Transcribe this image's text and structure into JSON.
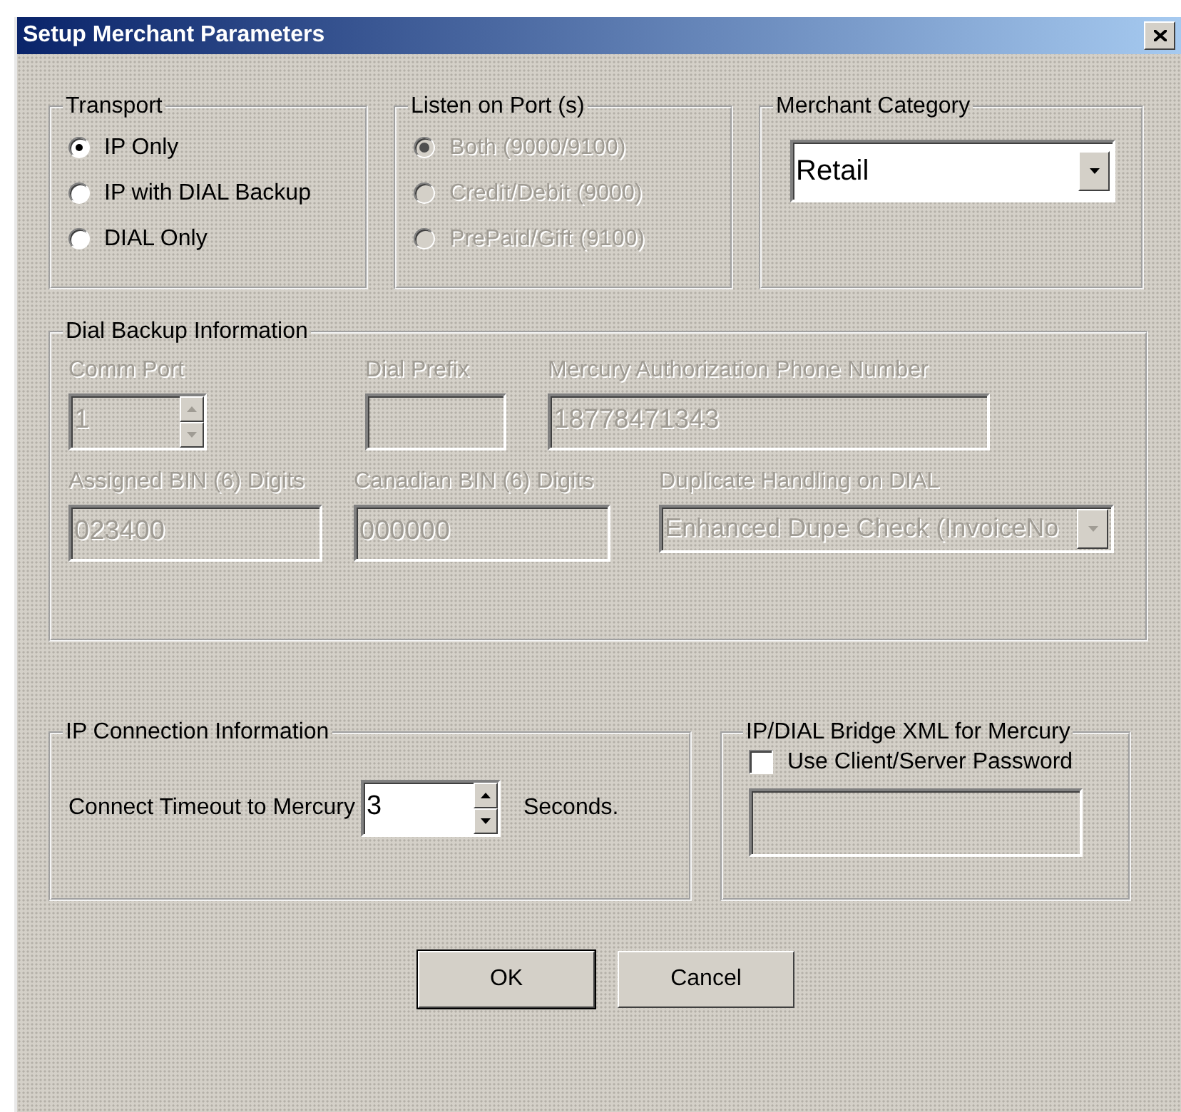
{
  "window": {
    "title": "Setup Merchant Parameters"
  },
  "transport": {
    "label": "Transport",
    "disabled": false,
    "options": [
      {
        "label": "IP Only",
        "selected": true
      },
      {
        "label": "IP with DIAL Backup",
        "selected": false
      },
      {
        "label": "DIAL Only",
        "selected": false
      }
    ]
  },
  "listen_port": {
    "label": "Listen on Port (s)",
    "disabled": true,
    "options": [
      {
        "label": "Both (9000/9100)",
        "selected": true
      },
      {
        "label": "Credit/Debit (9000)",
        "selected": false
      },
      {
        "label": "PrePaid/Gift (9100)",
        "selected": false
      }
    ]
  },
  "merchant_category": {
    "label": "Merchant Category",
    "value": "Retail",
    "disabled": false
  },
  "dial_backup": {
    "label": "Dial Backup Information",
    "rows": [
      [
        {
          "kind": "spinner",
          "label": "Comm Port",
          "value": "1",
          "disabled": true
        },
        {
          "kind": "text",
          "label": "Dial Prefix",
          "disabled": true
        },
        {
          "kind": "text",
          "label": "Mercury Authorization Phone Number",
          "value": "18778471343",
          "disabled": true
        }
      ],
      [
        {
          "kind": "text",
          "label": "Assigned BIN (6) Digits",
          "value": "023400",
          "disabled": true
        },
        {
          "kind": "text",
          "label": "Canadian BIN (6) Digits",
          "value": "000000",
          "disabled": true
        },
        {
          "kind": "select",
          "label": "Duplicate Handling on DIAL",
          "value": "Enhanced Dupe Check (InvoiceNo",
          "disabled": true
        }
      ]
    ]
  },
  "ip_connection": {
    "label": "IP Connection  Information",
    "timeout_label": "Connect Timeout to Mercury",
    "value": "3",
    "suffix": "Seconds.",
    "disabled": false
  },
  "bridge": {
    "label": "IP/DIAL Bridge XML for Mercury",
    "checkbox": {
      "label": "Use Client/Server Password",
      "checked": false
    },
    "password_disabled": true
  },
  "buttons": [
    {
      "label": "OK",
      "default": true
    },
    {
      "label": "Cancel",
      "default": false
    }
  ]
}
